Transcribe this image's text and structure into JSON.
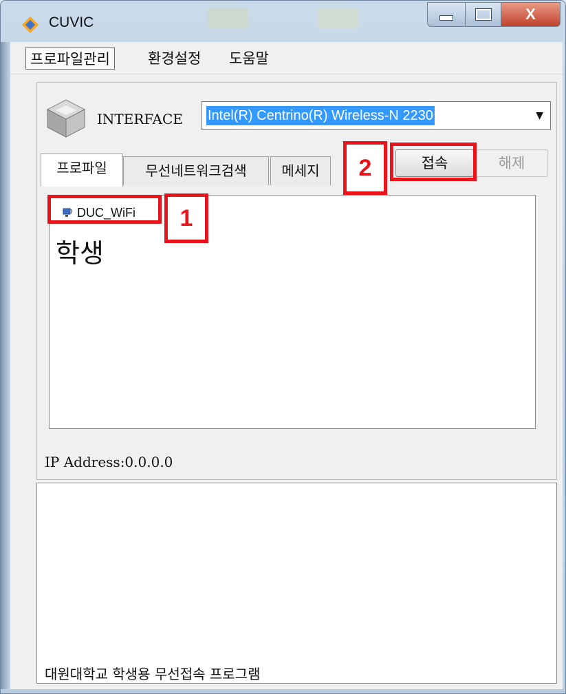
{
  "window": {
    "title": "CUVIC",
    "close_glyph": "X"
  },
  "menu": {
    "items": [
      "프로파일관리",
      "환경설정",
      "도움말"
    ]
  },
  "interface": {
    "label": "INTERFACE",
    "selected": "Intel(R) Centrino(R) Wireless-N 2230",
    "arrow": "▼"
  },
  "tabs": [
    "프로파일",
    "무선네트워크검색",
    "메세지"
  ],
  "buttons": {
    "connect": "접속",
    "disconnect": "해제"
  },
  "profiles": {
    "items": [
      "DUC_WiFi"
    ],
    "overlay_text": "학생"
  },
  "status": {
    "ip": "IP Address:0.0.0.0"
  },
  "footer": "대원대학교 학생용 무선접속 프로그램",
  "annotations": [
    "1",
    "2"
  ],
  "colors": {
    "annotation": "#e8141c",
    "selection": "#3399ff"
  }
}
